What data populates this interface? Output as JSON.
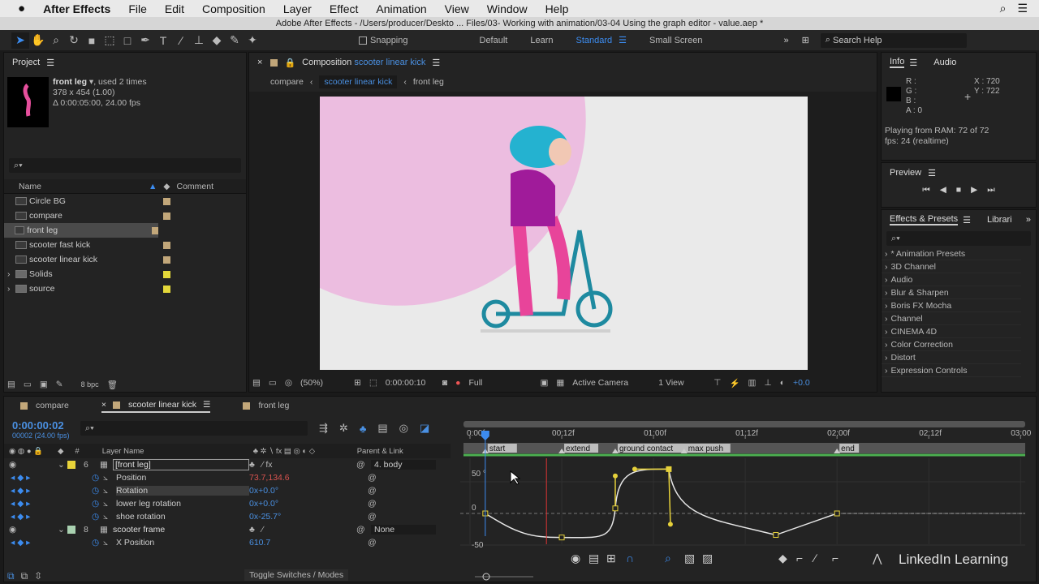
{
  "menubar": {
    "app": "After Effects",
    "items": [
      "File",
      "Edit",
      "Composition",
      "Layer",
      "Effect",
      "Animation",
      "View",
      "Window",
      "Help"
    ]
  },
  "titlebar": {
    "title": "Adobe After Effects - /Users/producer/Deskto ... Files/03- Working with animation/03-04 Using the graph editor - value.aep *"
  },
  "toolbar": {
    "snapping": "Snapping",
    "workspaces": [
      "Default",
      "Learn",
      "Standard",
      "Small Screen"
    ],
    "active_workspace": "Standard",
    "search_placeholder": "Search Help"
  },
  "project": {
    "title": "Project",
    "selected_name": "front leg",
    "used": ", used 2 times",
    "dims": "378 x 454 (1.00)",
    "duration": "Δ 0:00:05:00, 24.00 fps",
    "col_name": "Name",
    "col_comment": "Comment",
    "bpc": "8 bpc",
    "items": [
      {
        "name": "Circle BG",
        "type": "comp",
        "color": "#c2a77a"
      },
      {
        "name": "compare",
        "type": "comp",
        "color": "#c2a77a"
      },
      {
        "name": "front leg",
        "type": "comp",
        "color": "#c2a77a",
        "selected": true
      },
      {
        "name": "scooter fast kick",
        "type": "comp",
        "color": "#c2a77a"
      },
      {
        "name": "scooter linear kick",
        "type": "comp",
        "color": "#c2a77a"
      },
      {
        "name": "Solids",
        "type": "folder",
        "color": "#e4d83a"
      },
      {
        "name": "source",
        "type": "folder",
        "color": "#e4d83a"
      }
    ]
  },
  "composition": {
    "tab_prefix": "Composition",
    "tab_name": "scooter linear kick",
    "breadcrumbs": [
      "compare",
      "scooter linear kick",
      "front leg"
    ],
    "zoom": "(50%)",
    "timecode": "0:00:00:10",
    "resolution": "Full",
    "camera": "Active Camera",
    "views": "1 View",
    "exposure": "+0.0"
  },
  "info": {
    "tabs": [
      "Info",
      "Audio"
    ],
    "r": "R :",
    "g": "G :",
    "b": "B :",
    "a": "A :  0",
    "x": "X : 720",
    "y": "Y : 722",
    "status1": "Playing from RAM: 72 of 72",
    "status2": "fps: 24 (realtime)"
  },
  "preview": {
    "title": "Preview"
  },
  "effects": {
    "tabs": [
      "Effects & Presets",
      "Librari"
    ],
    "items": [
      "* Animation Presets",
      "3D Channel",
      "Audio",
      "Blur & Sharpen",
      "Boris FX Mocha",
      "Channel",
      "CINEMA 4D",
      "Color Correction",
      "Distort",
      "Expression Controls"
    ]
  },
  "timeline": {
    "tabs": [
      "compare",
      "scooter linear kick",
      "front leg"
    ],
    "active_tab": "scooter linear kick",
    "current_time": "0:00:00:02",
    "frame_info": "00002 (24.00 fps)",
    "col_num": "#",
    "col_layer": "Layer Name",
    "col_parent": "Parent & Link",
    "toggle": "Toggle Switches / Modes",
    "rows": [
      {
        "kind": "layer",
        "num": "6",
        "name": "[front leg]",
        "color": "#e8d33a",
        "parent": "4. body"
      },
      {
        "kind": "prop",
        "name": "Position",
        "value": "73.7,134.6",
        "value_color": "#d9534f"
      },
      {
        "kind": "prop",
        "name": "Rotation",
        "value": "0x+0.0°",
        "value_color": "#4a90e2",
        "selected": true
      },
      {
        "kind": "prop",
        "name": "lower leg rotation",
        "value": "0x+0.0°",
        "value_color": "#4a90e2"
      },
      {
        "kind": "prop",
        "name": "shoe rotation",
        "value": "0x-25.7°",
        "value_color": "#4a90e2"
      },
      {
        "kind": "layer",
        "num": "8",
        "name": "scooter frame",
        "color": "#a9d1b0",
        "parent": "None"
      },
      {
        "kind": "prop",
        "name": "X Position",
        "value": "610.7",
        "value_color": "#4a90e2"
      }
    ]
  },
  "graph_editor": {
    "time_ticks": [
      "0:00f",
      "00:12f",
      "01:00f",
      "01:12f",
      "02:00f",
      "02:12f",
      "03:00"
    ],
    "value_ticks": [
      "50 °",
      "0",
      "-50"
    ],
    "markers": [
      {
        "label": "start",
        "frame": 2
      },
      {
        "label": "extend",
        "frame": 12
      },
      {
        "label": "ground contact",
        "frame": 19
      },
      {
        "label": "max push",
        "frame": 28
      },
      {
        "label": "end",
        "frame": 48
      }
    ],
    "current_frame": 2,
    "keyframes": [
      {
        "frame": 2,
        "value": 0
      },
      {
        "frame": 12,
        "value": -38
      },
      {
        "frame": 19,
        "value": 8
      },
      {
        "frame": 26,
        "value": 70
      },
      {
        "frame": 40,
        "value": -34
      },
      {
        "frame": 48,
        "value": 0
      }
    ],
    "watermark": "LinkedIn Learning"
  }
}
